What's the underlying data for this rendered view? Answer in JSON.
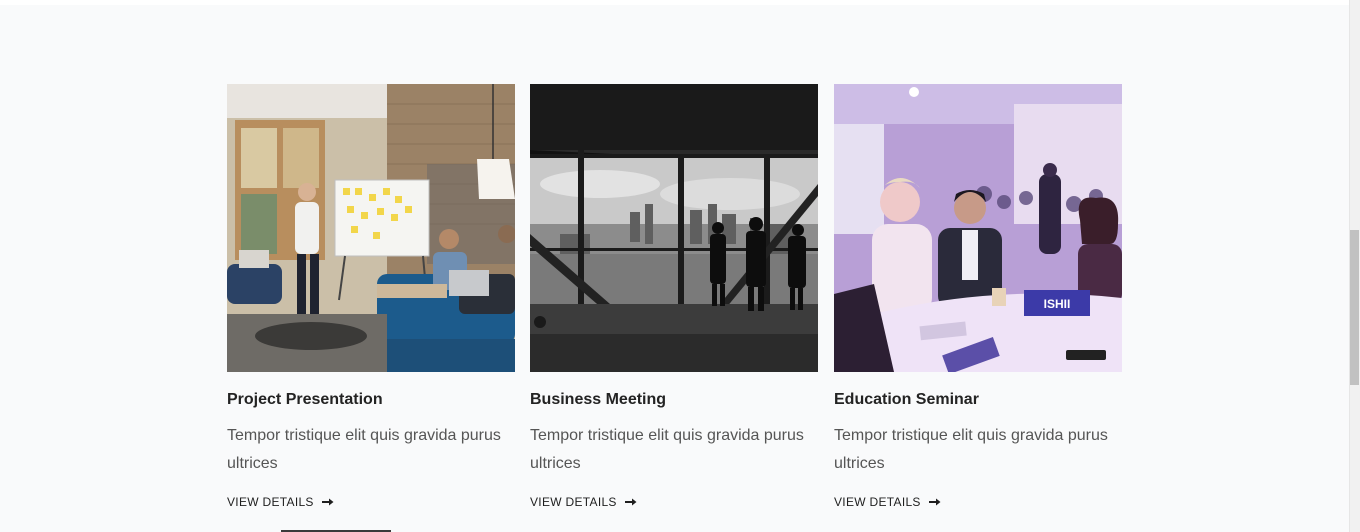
{
  "cards": [
    {
      "title": "Project Presentation",
      "description": "Tempor tristique elit quis gravida purus ultrices",
      "link_label": "VIEW DETAILS",
      "image_alt": "team presentation at whiteboard"
    },
    {
      "title": "Business Meeting",
      "description": "Tempor tristique elit quis gravida purus ultrices",
      "link_label": "VIEW DETAILS",
      "image_alt": "silhouettes by city window"
    },
    {
      "title": "Education Seminar",
      "description": "Tempor tristique elit quis gravida purus ultrices",
      "link_label": "VIEW DETAILS",
      "image_alt": "conference audience"
    }
  ],
  "seminar_sign_text": "ISHII",
  "icons": {
    "link_arrow": "arrow-right-icon"
  },
  "colors": {
    "background": "#f9fafb",
    "title": "#232323",
    "text": "#555555"
  }
}
